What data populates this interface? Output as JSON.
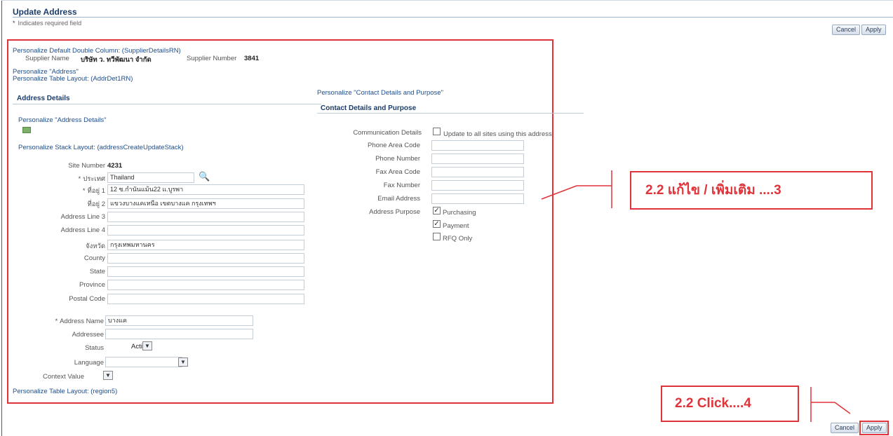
{
  "page": {
    "title": "Update Address",
    "required_note_star": "*",
    "required_note": "Indicates required field"
  },
  "buttons": {
    "cancel": "Cancel",
    "apply": "Apply"
  },
  "personalize": {
    "double_column": "Personalize Default Double Column: (SupplierDetailsRN)",
    "address": "Personalize \"Address\"",
    "table_layout": "Personalize Table Layout: (AddrDet1RN)",
    "address_details": "Personalize \"Address Details\"",
    "stack_layout": "Personalize Stack Layout: (addressCreateUpdateStack)",
    "table_layout_region5": "Personalize Table Layout: (region5)",
    "contact_details": "Personalize \"Contact Details and Purpose\""
  },
  "supplier": {
    "name_label": "Supplier Name",
    "name_value": "บริษัท ว. ทวีพัฒนา จำกัด",
    "number_label": "Supplier Number",
    "number_value": "3841"
  },
  "address_details": {
    "heading": "Address Details",
    "icon_name": "edit-icon",
    "site_number_label": "Site Number",
    "site_number_value": "4231",
    "country_label": "ประเทศ",
    "country_value": "Thailand",
    "address1_label": "ที่อยู่ 1",
    "address1_value": "12 ซ.กำนันแม้น22 แ.บูรพา",
    "address2_label": "ที่อยู่ 2",
    "address2_value": "แขวงบางแคเหนือ เขตบางแค กรุงเทพฯ",
    "address_line3_label": "Address Line 3",
    "address_line4_label": "Address Line 4",
    "province_th_label": "จังหวัด",
    "province_th_value": "กรุงเทพมหานคร",
    "county_label": "County",
    "state_label": "State",
    "province_label": "Province",
    "postal_code_label": "Postal Code",
    "address_name_label": "Address Name",
    "address_name_value": "บางแค",
    "addressee_label": "Addressee",
    "status_label": "Status",
    "status_value": "Active",
    "language_label": "Language",
    "context_value_label": "Context Value"
  },
  "contact": {
    "heading": "Contact Details and Purpose",
    "communication_label": "Communication Details",
    "update_all_sites": "Update to all sites using this address",
    "phone_area_code_label": "Phone Area Code",
    "phone_number_label": "Phone Number",
    "fax_area_code_label": "Fax Area Code",
    "fax_number_label": "Fax Number",
    "email_label": "Email Address",
    "purpose_label": "Address Purpose",
    "purchasing": "Purchasing",
    "payment": "Payment",
    "rfq_only": "RFQ Only"
  },
  "callouts": {
    "edit_note": "2.2 แก้ไข / เพิ่มเติม ....3",
    "click_note": "2.2 Click....4"
  },
  "colors": {
    "annotation_red": "#e0333a",
    "link_blue": "#1f4d8c",
    "header_blue": "#1c3d69"
  }
}
